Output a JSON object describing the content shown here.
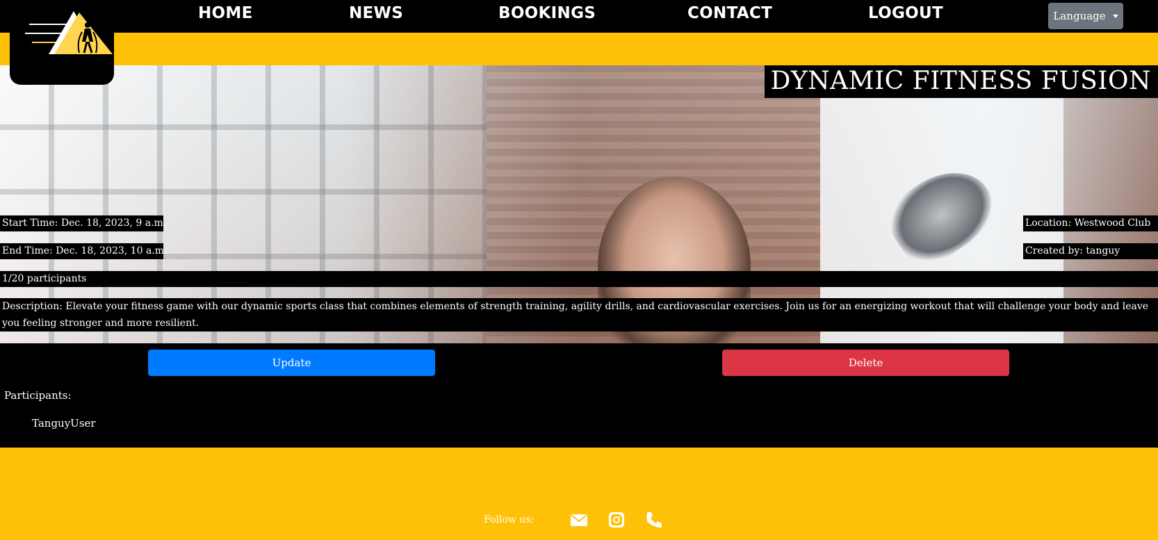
{
  "nav": {
    "items": [
      "HOME",
      "NEWS",
      "BOOKINGS",
      "CONTACT",
      "LOGOUT"
    ],
    "language_label": "Language"
  },
  "class": {
    "title": "DYNAMIC FITNESS FUSION",
    "start_time": "Start Time: Dec. 18, 2023, 9 a.m.",
    "end_time": "End Time: Dec. 18, 2023, 10 a.m.",
    "location": "Location: Westwood Club",
    "created_by": "Created by: tanguy",
    "participants_count": "1/20 participants",
    "description": "Description: Elevate your fitness game with our dynamic sports class that combines elements of strength training, agility drills, and cardiovascular exercises. Join us for an energizing workout that will challenge your body and leave you feeling stronger and more resilient."
  },
  "actions": {
    "update_label": "Update",
    "delete_label": "Delete"
  },
  "participants": {
    "label": "Participants:",
    "list": [
      "TanguyUser"
    ]
  },
  "footer": {
    "follow_label": "Follow us:",
    "icons": [
      "envelope-icon",
      "instagram-icon",
      "phone-icon"
    ]
  },
  "colors": {
    "accent_yellow": "#ffc107",
    "update_blue": "#007bff",
    "delete_red": "#dc3545",
    "language_gray": "#6c757d"
  }
}
